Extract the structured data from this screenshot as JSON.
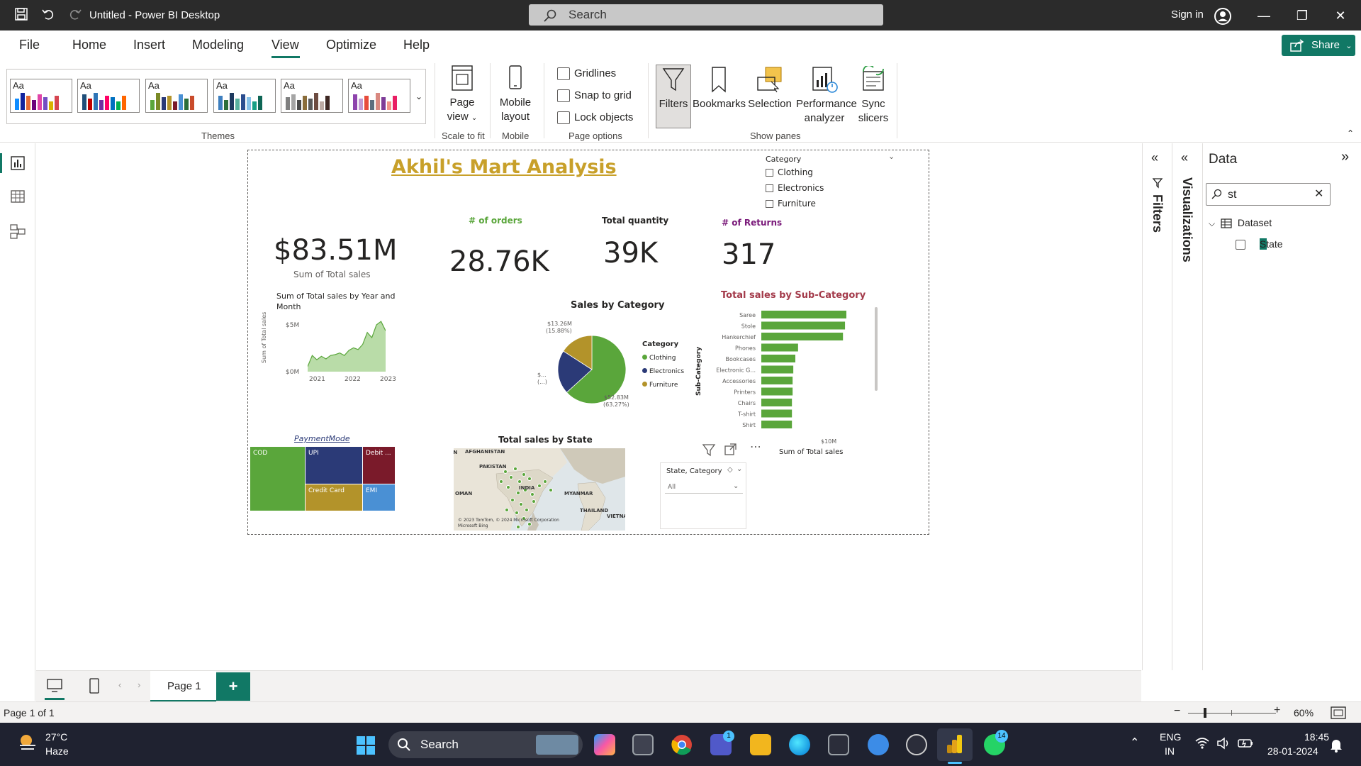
{
  "window": {
    "title": "Untitled - Power BI Desktop",
    "search_placeholder": "Search",
    "sign_in": "Sign in"
  },
  "menu": {
    "items": [
      "File",
      "Home",
      "Insert",
      "Modeling",
      "View",
      "Optimize",
      "Help"
    ],
    "active": "View",
    "share_label": "Share"
  },
  "ribbon": {
    "themes_label": "Themes",
    "page_view_label": "Page view",
    "scale_to_fit_label": "Scale to fit",
    "mobile_layout_label": "Mobile layout",
    "mobile_label": "Mobile",
    "gridlines_label": "Gridlines",
    "snap_label": "Snap to grid",
    "lock_label": "Lock objects",
    "page_options_label": "Page options",
    "filters_label": "Filters",
    "bookmarks_label": "Bookmarks",
    "selection_label": "Selection",
    "performance_label": "Performance analyzer",
    "sync_label": "Sync slicers",
    "show_panes_label": "Show panes",
    "theme_text": "Aa"
  },
  "report": {
    "title": "Akhil's Mart Analysis",
    "kpis": {
      "total_sales_value": "$83.51M",
      "total_sales_label": "Sum of Total sales",
      "orders_label": "# of orders",
      "orders_value": "28.76K",
      "quantity_label": "Total quantity",
      "quantity_value": "39K",
      "returns_label": "# of Returns",
      "returns_value": "317"
    },
    "category_slicer": {
      "title": "Category",
      "options": [
        "Clothing",
        "Electronics",
        "Furniture"
      ]
    },
    "area_chart": {
      "title": "Sum of Total sales by Year and Month",
      "ylabel": "Sum of Total sales",
      "y_ticks": [
        "$5M",
        "$0M"
      ],
      "x_ticks": [
        "2021",
        "2022",
        "2023"
      ]
    },
    "pie": {
      "title": "Sales by Category",
      "legend_title": "Category",
      "labels": {
        "top": "$13.26M",
        "top_pct": "(15.88%)",
        "left": "$...",
        "left_sub": "(...)",
        "bottom": "$52.83M",
        "bottom_pct": "(63.27%)"
      }
    },
    "bar_chart": {
      "title": "Total sales by Sub-Category",
      "ylabel": "Sub-Category",
      "xlabel": "Sum of Total sales",
      "x_tick": "$10M"
    },
    "treemap": {
      "title": "PaymentMode",
      "tiles": [
        "COD",
        "UPI",
        "Debit ...",
        "Credit Card",
        "EMI"
      ]
    },
    "map": {
      "title": "Total sales by State",
      "labels": [
        "AFGHANISTAN",
        "PAKISTAN",
        "INDIA",
        "MYANMAR",
        "THAILAND",
        "VIETNA",
        "OMAN",
        "AN"
      ],
      "copyright": "© 2023 TomTom, © 2024 Microsoft Corporation",
      "bing": "Microsoft Bing"
    },
    "state_slicer": {
      "title": "State, Category",
      "value": "All"
    }
  },
  "chart_data": [
    {
      "type": "pie",
      "title": "Sales by Category",
      "legend_title": "Category",
      "categories": [
        "Clothing",
        "Electronics",
        "Furniture"
      ],
      "values": [
        63.27,
        20.85,
        15.88
      ],
      "colors": [
        "#5aa63b",
        "#2b3a77",
        "#b3932a"
      ]
    },
    {
      "type": "bar",
      "title": "Total sales by Sub-Category",
      "ylabel": "Sub-Category",
      "xlabel": "Sum of Total sales",
      "categories": [
        "Saree",
        "Stole",
        "Hankerchief",
        "Phones",
        "Bookcases",
        "Electronic G...",
        "Accessories",
        "Printers",
        "Chairs",
        "T-shirt",
        "Shirt"
      ],
      "values": [
        12.5,
        12.3,
        12.0,
        5.4,
        5.0,
        4.7,
        4.6,
        4.6,
        4.5,
        4.5,
        4.5
      ],
      "color": "#5aa63b"
    },
    {
      "type": "area",
      "title": "Sum of Total sales by Year and Month",
      "ylabel": "Sum of Total sales",
      "x": [
        "2021-01",
        "2021-03",
        "2021-05",
        "2021-07",
        "2021-09",
        "2021-11",
        "2022-01",
        "2022-03",
        "2022-05",
        "2022-07",
        "2022-09",
        "2022-11",
        "2023-01",
        "2023-03",
        "2023-05",
        "2023-07",
        "2023-09",
        "2023-11"
      ],
      "values": [
        0.6,
        1.9,
        1.4,
        1.8,
        1.5,
        1.9,
        2.0,
        2.2,
        1.9,
        2.5,
        2.8,
        2.6,
        3.2,
        4.6,
        4.0,
        5.5,
        5.9,
        4.8
      ],
      "ylim": [
        0,
        6
      ],
      "y_ticks": [
        "$5M",
        "$0M"
      ],
      "x_ticks": [
        "2021",
        "2022",
        "2023"
      ],
      "color": "#5aa63b"
    },
    {
      "type": "treemap",
      "title": "PaymentMode",
      "categories": [
        "COD",
        "UPI",
        "Debit ...",
        "Credit Card",
        "EMI"
      ],
      "colors": [
        "#5aa63b",
        "#2b3a77",
        "#7a1a2a",
        "#b3932a",
        "#4a90d4"
      ]
    }
  ],
  "data_pane": {
    "title": "Data",
    "search_value": "st",
    "dataset_label": "Dataset",
    "field_label": "State",
    "filters_label": "Filters",
    "visualizations_label": "Visualizations"
  },
  "page_tabs": {
    "page_label": "Page 1",
    "add_label": "+"
  },
  "status": {
    "page_info": "Page 1 of 1",
    "zoom": "60%"
  },
  "taskbar": {
    "temp": "27°C",
    "weather": "Haze",
    "search_label": "Search",
    "lang": "ENG",
    "region": "IN",
    "time": "18:45",
    "date": "28-01-2024",
    "teams_badge": "1",
    "whatsapp_badge": "14"
  }
}
